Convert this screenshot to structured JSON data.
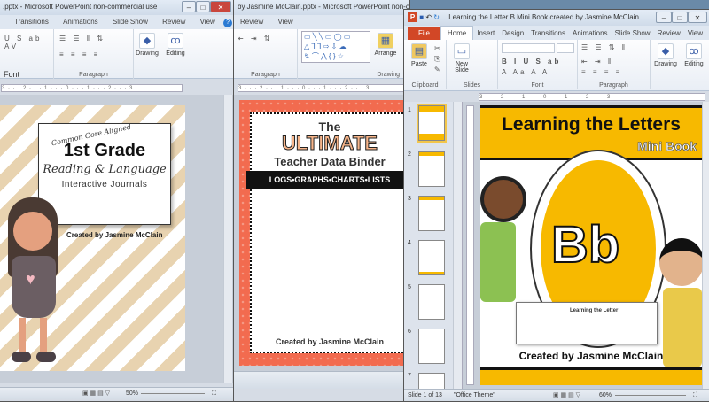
{
  "windows": [
    {
      "title": ".pptx - Microsoft PowerPoint non-commercial use",
      "tabs": [
        "Transitions",
        "Animations",
        "Slide Show",
        "Review",
        "View"
      ],
      "groups": [
        "Font",
        "Paragraph"
      ],
      "buttons": [
        "Drawing",
        "Editing"
      ],
      "ruler": "3 · · · 2 · · · 1 · · · 0 · · · 1 · · · 2 · · · 3",
      "zoom": "50%",
      "slide": {
        "subtitle": "Common Core Aligned",
        "title": "1st Grade",
        "line2": "Reading & Language",
        "line3": "Interactive Journals",
        "credit": "Created by Jasmine McClain"
      }
    },
    {
      "title": "by Jasmine McClain.pptx - Microsoft PowerPoint non-commercial use",
      "tabs": [
        "Review",
        "View"
      ],
      "groups": [
        "Paragraph",
        "Drawing"
      ],
      "buttons": [
        "Arrange"
      ],
      "ruler": "3 · · · 2 · · · 1 · · · 0 · · · 1 · · · 2 · · · 3",
      "slide": {
        "the": "The",
        "ultimate": "ULTIMATE",
        "title": "Teacher Data Binder",
        "banner": "LOGS•GRAPHS•CHARTS•LISTS",
        "credit": "Created by Jasmine McClain"
      }
    },
    {
      "title": "Learning the Letter B Mini Book created by Jasmine McClain...",
      "file_tab": "File",
      "tabs": [
        "Home",
        "Insert",
        "Design",
        "Transitions",
        "Animations",
        "Slide Show",
        "Review",
        "View"
      ],
      "active_tab": "Home",
      "groups": [
        "Clipboard",
        "Slides",
        "Font",
        "Paragraph"
      ],
      "buttons": [
        "Paste",
        "New Slide",
        "Drawing",
        "Editing"
      ],
      "ruler": "3 · · · 2 · · · 1 · · · 0 · · · 1 · · · 2 · · · 3",
      "thumbnails": [
        "1",
        "2",
        "3",
        "4",
        "5",
        "6",
        "7"
      ],
      "status": {
        "slide": "Slide 1 of 13",
        "theme": "\"Office Theme\"",
        "zoom": "60%"
      },
      "slide": {
        "title": "Learning the Letters",
        "subtitle": "Mini Book",
        "letter": "Bb",
        "credit": "Created by Jasmine McClain",
        "mini": "Learning the Letter"
      }
    }
  ],
  "colors": {
    "file_tab": "#d24726",
    "yellow": "#f7b900",
    "coral": "#f26b4f",
    "tan": "#e8d3b0"
  }
}
